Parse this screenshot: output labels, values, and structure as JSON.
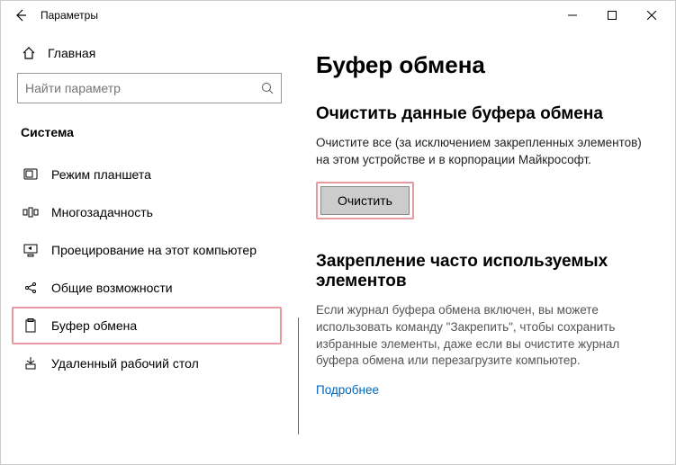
{
  "window": {
    "title": "Параметры"
  },
  "sidebar": {
    "home": "Главная",
    "search_placeholder": "Найти параметр",
    "section": "Система",
    "items": [
      {
        "label": "Режим планшета"
      },
      {
        "label": "Многозадачность"
      },
      {
        "label": "Проецирование на этот компьютер"
      },
      {
        "label": "Общие возможности"
      },
      {
        "label": "Буфер обмена"
      },
      {
        "label": "Удаленный рабочий стол"
      }
    ]
  },
  "main": {
    "title": "Буфер обмена",
    "clear": {
      "heading": "Очистить данные буфера обмена",
      "desc": "Очистите все (за исключением закрепленных элементов) на этом устройстве и в корпорации Майкрософт.",
      "button": "Очистить"
    },
    "pin": {
      "heading": "Закрепление часто используемых элементов",
      "desc": "Если журнал буфера обмена включен, вы можете использовать команду \"Закрепить\", чтобы сохранить избранные элементы, даже если вы очистите журнал буфера обмена или перезагрузите компьютер.",
      "link": "Подробнее"
    }
  }
}
